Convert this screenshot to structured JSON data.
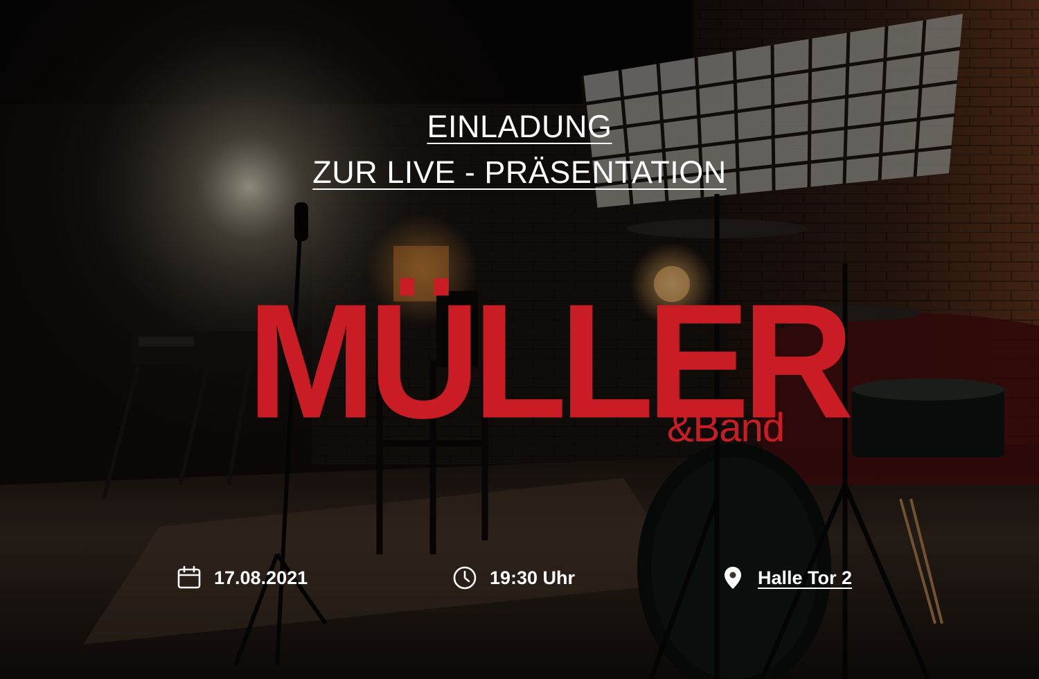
{
  "invitation": {
    "line1": "EINLADUNG",
    "line2": "ZUR LIVE - PRÄSENTATION"
  },
  "logo": {
    "name": "MÜLLER",
    "sub": "&Band",
    "color": "#c91c24"
  },
  "event": {
    "date": "17.08.2021",
    "time": "19:30 Uhr",
    "place": "Halle Tor 2",
    "icons": {
      "date": "calendar-icon",
      "time": "clock-icon",
      "place": "location-pin-icon"
    }
  },
  "background": {
    "scene": "dark-stage-with-drums-and-microphone"
  }
}
